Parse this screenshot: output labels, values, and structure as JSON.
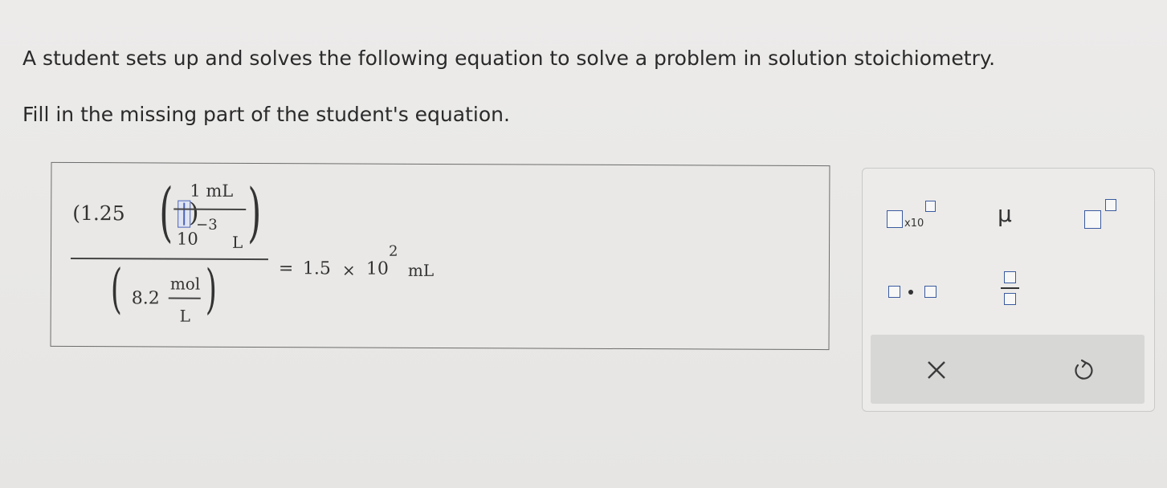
{
  "question": {
    "line1": "A student sets up and solves the following equation to solve a problem in solution stoichiometry.",
    "line2": "Fill in the missing part of the student's equation."
  },
  "equation": {
    "coef": "(1.25",
    "num_top": "1 mL",
    "num_bottom_base": "10",
    "num_bottom_exp": "−3",
    "num_bottom_unit": "L",
    "den_value": "8.2",
    "den_top": "mol",
    "den_bottom": "L",
    "rhs_equals": "=",
    "rhs_value": "1.5",
    "rhs_times": "×",
    "rhs_base": "10",
    "rhs_exp": "2",
    "rhs_unit": "mL"
  },
  "toolbar": {
    "sci_label": "x10",
    "mu": "μ",
    "clear_icon": "close-icon",
    "undo_icon": "undo-icon"
  }
}
